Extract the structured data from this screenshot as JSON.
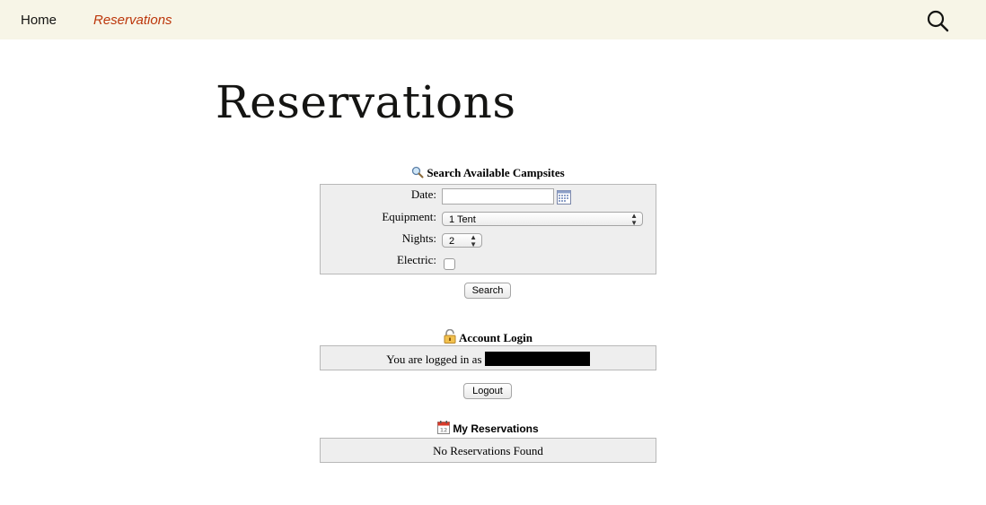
{
  "nav": {
    "home_label": "Home",
    "reservations_label": "Reservations",
    "active_color": "#bc360a",
    "background_color": "#f7f5e7"
  },
  "page": {
    "title": "Reservations"
  },
  "search": {
    "heading": "Search Available Campsites",
    "icon": "magnifier-icon",
    "date_label": "Date:",
    "date_value": "",
    "equipment_label": "Equipment:",
    "equipment_value": "1 Tent",
    "nights_label": "Nights:",
    "nights_value": "2",
    "electric_label": "Electric:",
    "electric_checked": false,
    "button_label": "Search"
  },
  "login": {
    "heading": "Account Login",
    "icon": "padlock-icon",
    "status_prefix": "You are logged in as",
    "username_redacted": true,
    "button_label": "Logout"
  },
  "reservations": {
    "heading": "My Reservations",
    "icon": "calendar-icon",
    "empty_text": "No Reservations Found"
  }
}
